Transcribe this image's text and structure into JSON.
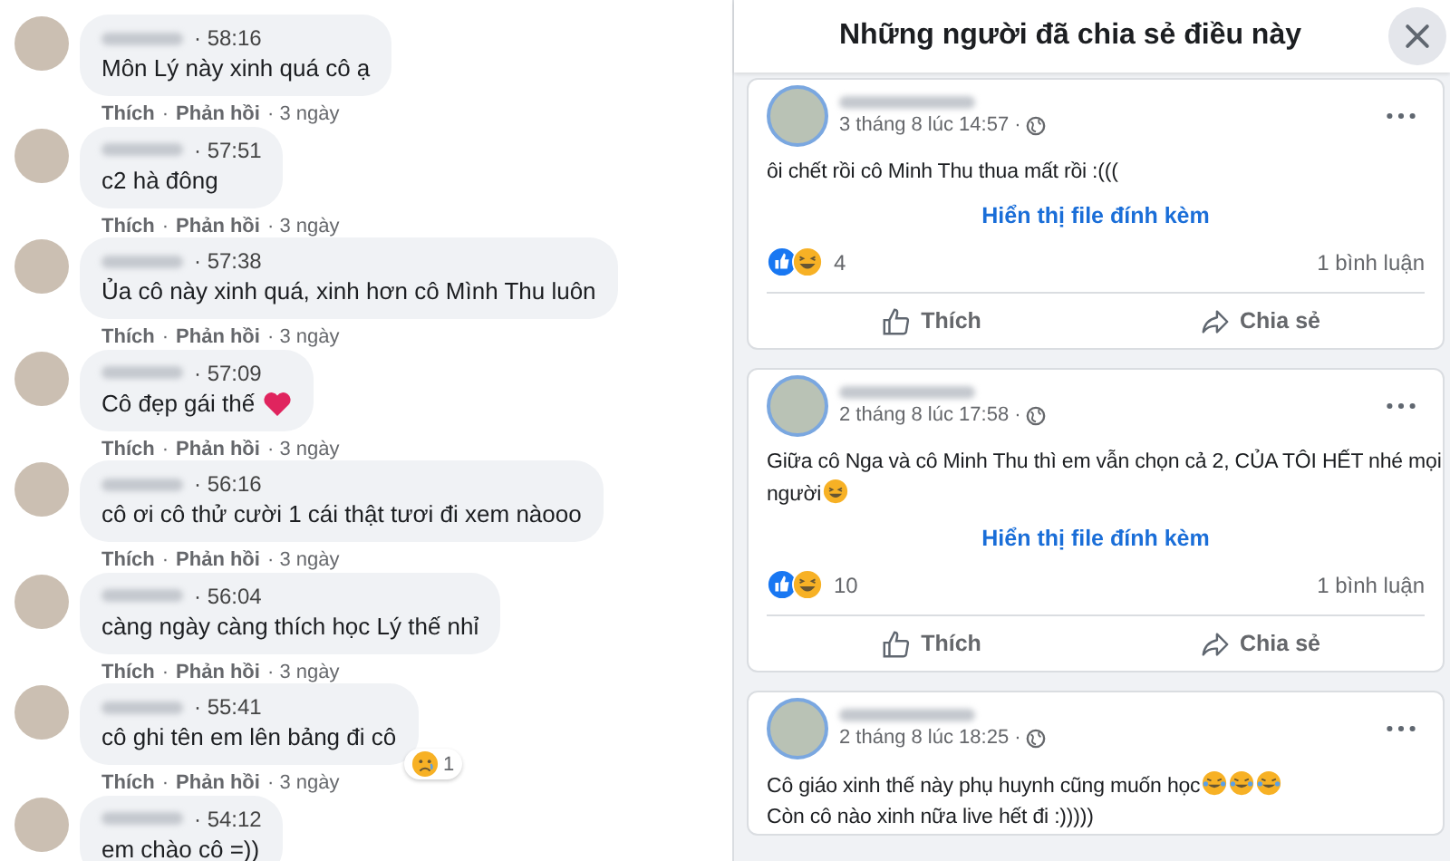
{
  "comments": [
    {
      "time": "· 58:16",
      "text": "Môn Lý này xinh quá cô ạ",
      "heart": false,
      "like": "Thích",
      "sep": "·",
      "reply": "Phản hồi",
      "age": "· 3 ngày"
    },
    {
      "time": "· 57:51",
      "text": "c2 hà đông",
      "heart": false,
      "like": "Thích",
      "sep": "·",
      "reply": "Phản hồi",
      "age": "· 3 ngày"
    },
    {
      "time": "· 57:38",
      "text": "Ủa cô này xinh quá, xinh hơn cô Mình Thu luôn",
      "heart": false,
      "like": "Thích",
      "sep": "·",
      "reply": "Phản hồi",
      "age": "· 3 ngày"
    },
    {
      "time": "· 57:09",
      "text": "Cô đẹp gái thế",
      "heart": true,
      "like": "Thích",
      "sep": "·",
      "reply": "Phản hồi",
      "age": "· 3 ngày"
    },
    {
      "time": "· 56:16",
      "text": "cô ơi cô thử cười 1 cái thật tươi đi xem nàooo",
      "heart": false,
      "like": "Thích",
      "sep": "·",
      "reply": "Phản hồi",
      "age": "· 3 ngày"
    },
    {
      "time": "· 56:04",
      "text": "càng ngày càng thích học Lý thế nhỉ",
      "heart": false,
      "like": "Thích",
      "sep": "·",
      "reply": "Phản hồi",
      "age": "· 3 ngày"
    },
    {
      "time": "· 55:41",
      "text": "cô ghi tên em lên bảng đi cô",
      "heart": false,
      "reaction_count": "1",
      "like": "Thích",
      "sep": "·",
      "reply": "Phản hồi",
      "age": "· 3 ngày"
    },
    {
      "time": "· 54:12",
      "text": "em chào cô =))",
      "heart": false
    }
  ],
  "share_panel": {
    "title": "Những người đã chia sẻ điều này",
    "posts": [
      {
        "time": "3 tháng 8 lúc 14:57 ·",
        "lines": [
          {
            "text": "ôi chết rồi cô Minh Thu thua mất rồi :(((",
            "kind": "plain"
          }
        ],
        "attachment_link": "Hiển thị file đính kèm",
        "reaction_count": "4",
        "comment_count": "1 bình luận",
        "like": "Thích",
        "share": "Chia sẻ"
      },
      {
        "time": "2 tháng 8 lúc 17:58 ·",
        "lines": [
          {
            "text": "Giữa cô Nga và cô Minh Thu thì em vẫn chọn cả 2, CỦA TÔI HẾT nhé mọi",
            "kind": "plain"
          },
          {
            "text": "người",
            "kind": "smile"
          }
        ],
        "attachment_link": "Hiển thị file đính kèm",
        "reaction_count": "10",
        "comment_count": "1 bình luận",
        "like": "Thích",
        "share": "Chia sẻ"
      },
      {
        "time": "2 tháng 8 lúc 18:25 ·",
        "lines": [
          {
            "text": "Cô giáo xinh thế này phụ huynh cũng muốn học",
            "kind": "laughs"
          },
          {
            "text": "Còn cô nào xinh nữa live hết đi :)))))",
            "kind": "plain"
          }
        ]
      }
    ]
  }
}
